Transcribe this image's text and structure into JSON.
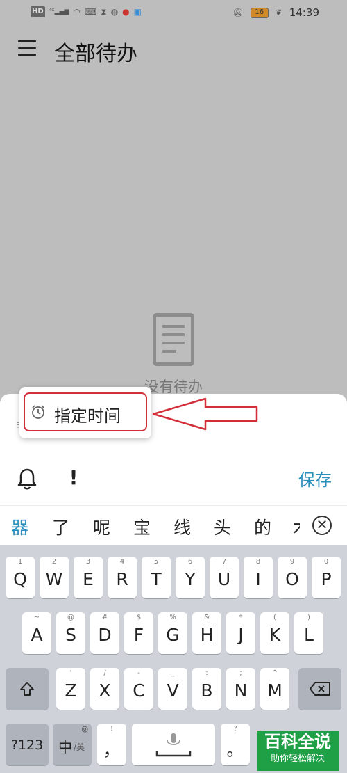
{
  "status_bar": {
    "left_icons": [
      "HD",
      "4G",
      "signal-icon",
      "wifi-icon",
      "keyboard-icon",
      "hourglass-icon",
      "browser-icon",
      "app-icon",
      "translate-icon"
    ],
    "battery": "16",
    "time": "14:39"
  },
  "appbar": {
    "title": "全部待办"
  },
  "empty_state": {
    "text": "没有待办"
  },
  "sheet": {
    "input_hint": "≡",
    "save_label": "保存"
  },
  "popup": {
    "item_label": "指定时间"
  },
  "suggestions": [
    "器",
    "了",
    "呢",
    "宝",
    "线",
    "头",
    "的",
    "木"
  ],
  "keyboard": {
    "row1": [
      {
        "sub": "1",
        "main": "Q"
      },
      {
        "sub": "2",
        "main": "W"
      },
      {
        "sub": "3",
        "main": "E"
      },
      {
        "sub": "4",
        "main": "R"
      },
      {
        "sub": "5",
        "main": "T"
      },
      {
        "sub": "6",
        "main": "Y"
      },
      {
        "sub": "7",
        "main": "U"
      },
      {
        "sub": "8",
        "main": "I"
      },
      {
        "sub": "9",
        "main": "O"
      },
      {
        "sub": "0",
        "main": "P"
      }
    ],
    "row2": [
      {
        "sub": "~",
        "main": "A"
      },
      {
        "sub": "@",
        "main": "S"
      },
      {
        "sub": "#",
        "main": "D"
      },
      {
        "sub": "$",
        "main": "F"
      },
      {
        "sub": "%",
        "main": "G"
      },
      {
        "sub": "&",
        "main": "H"
      },
      {
        "sub": "*",
        "main": "J"
      },
      {
        "sub": "(",
        "main": "K"
      },
      {
        "sub": ")",
        "main": "L"
      }
    ],
    "row3": [
      {
        "sub": "'",
        "main": "Z"
      },
      {
        "sub": "/",
        "main": "X"
      },
      {
        "sub": "-",
        "main": "C"
      },
      {
        "sub": "_",
        "main": "V"
      },
      {
        "sub": ":",
        "main": "B"
      },
      {
        "sub": ";",
        "main": "N"
      },
      {
        "sub": "^",
        "main": "M"
      }
    ],
    "row4": {
      "sym": "?123",
      "lang_main": "中",
      "lang_sub": "/英",
      "comma": "，",
      "comma_sub": "!",
      "period": "。",
      "period_sub": "?"
    }
  },
  "watermark": {
    "title": "百科全说",
    "subtitle": "助你轻松解决"
  },
  "colors": {
    "accent": "#2a8fbd",
    "highlight": "#d32f3a",
    "overlay": "#bdbdbd"
  }
}
